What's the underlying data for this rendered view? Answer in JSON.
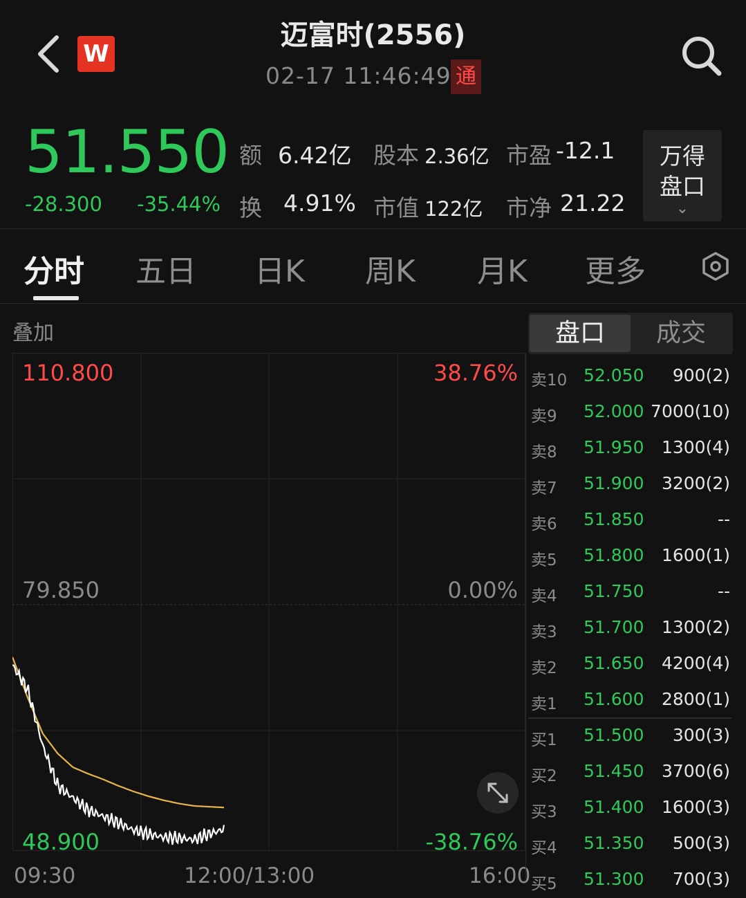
{
  "header": {
    "title": "迈富时(2556)",
    "datetime": "02-17 11:46:49",
    "badge": "通",
    "logo_letter": "W",
    "icons": [
      "back-arrow-icon",
      "search-icon"
    ]
  },
  "quote": {
    "price": "51.550",
    "change": "-28.300",
    "change_pct": "-35.44%",
    "stats": [
      {
        "label": "额",
        "value": "6.42亿"
      },
      {
        "label": "股本",
        "value": "2.36亿"
      },
      {
        "label": "市盈",
        "value": "-12.1"
      },
      {
        "label": "换",
        "value": "4.91%"
      },
      {
        "label": "市值",
        "value": "122亿"
      },
      {
        "label": "市净",
        "value": "21.22"
      }
    ],
    "wande_button": [
      "万得",
      "盘口"
    ]
  },
  "tabs": [
    "分时",
    "五日",
    "日K",
    "周K",
    "月K",
    "更多"
  ],
  "active_tab": 0,
  "chart": {
    "overlay_label": "叠加",
    "y_left": [
      "110.800",
      "79.850",
      "48.900"
    ],
    "y_right": [
      "38.76%",
      "0.00%",
      "-38.76%"
    ],
    "x_labels": [
      "09:30",
      "12:00/13:00",
      "16:00"
    ]
  },
  "chart_data": {
    "type": "line",
    "ylim": [
      48.9,
      110.8
    ],
    "x_session": [
      "09:30",
      "12:00/13:00",
      "16:00"
    ],
    "series": [
      {
        "values": [
          72.0,
          69.0,
          62.0,
          57.0,
          55.5,
          54.0,
          53.2,
          52.4,
          51.5,
          51.0,
          50.6,
          50.5,
          50.3,
          51.0,
          51.6
        ]
      },
      {
        "values": [
          73.0,
          68.0,
          63.5,
          61.0,
          59.3,
          58.5,
          57.8,
          57.0,
          56.3,
          55.7,
          55.2,
          54.8,
          54.5,
          54.4,
          54.3
        ]
      }
    ],
    "colors": {
      "price": "#ffffff",
      "avg": "#e7b54a"
    }
  },
  "orderbook": {
    "tabs": [
      "盘口",
      "成交"
    ],
    "asks": [
      {
        "label": "卖10",
        "price": "52.050",
        "vol": "900(2)"
      },
      {
        "label": "卖9",
        "price": "52.000",
        "vol": "7000(10)"
      },
      {
        "label": "卖8",
        "price": "51.950",
        "vol": "1300(4)"
      },
      {
        "label": "卖7",
        "price": "51.900",
        "vol": "3200(2)"
      },
      {
        "label": "卖6",
        "price": "51.850",
        "vol": "--"
      },
      {
        "label": "卖5",
        "price": "51.800",
        "vol": "1600(1)"
      },
      {
        "label": "卖4",
        "price": "51.750",
        "vol": "--"
      },
      {
        "label": "卖3",
        "price": "51.700",
        "vol": "1300(2)"
      },
      {
        "label": "卖2",
        "price": "51.650",
        "vol": "4200(4)"
      },
      {
        "label": "卖1",
        "price": "51.600",
        "vol": "2800(1)"
      }
    ],
    "bids": [
      {
        "label": "买1",
        "price": "51.500",
        "vol": "300(3)"
      },
      {
        "label": "买2",
        "price": "51.450",
        "vol": "3700(6)"
      },
      {
        "label": "买3",
        "price": "51.400",
        "vol": "1600(3)"
      },
      {
        "label": "买4",
        "price": "51.350",
        "vol": "500(3)"
      },
      {
        "label": "买5",
        "price": "51.300",
        "vol": "700(3)"
      }
    ]
  },
  "colors": {
    "up_red": "#ff4a4a",
    "down_green": "#2ec95a",
    "background": "#121212"
  }
}
